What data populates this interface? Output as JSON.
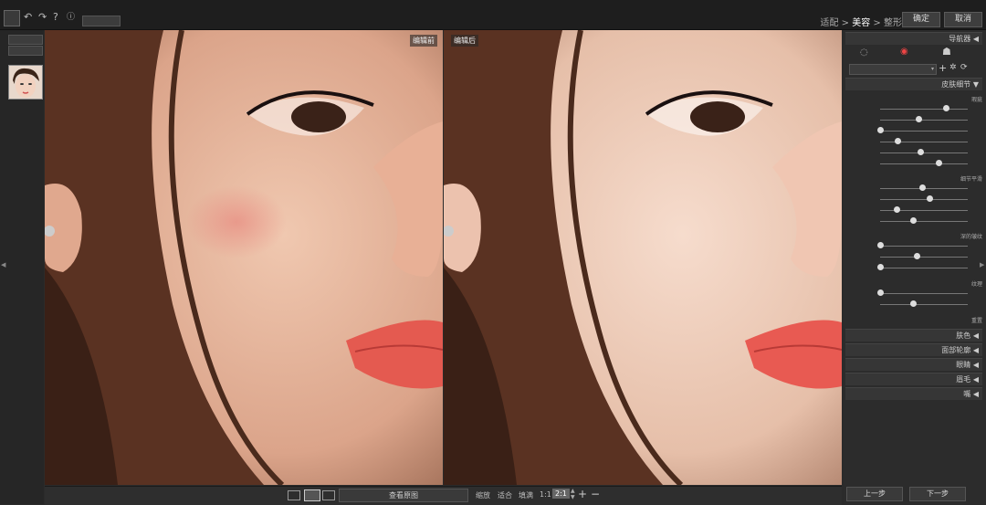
{
  "topbar": {
    "undo_icon": "undo-icon",
    "redo_icon": "redo-icon",
    "help_icon": "question-icon",
    "info_icon": "info-icon",
    "small_button": "",
    "breadcrumb": {
      "step1": "适配",
      "sep1": " > ",
      "step2": "美容",
      "sep2": " > ",
      "step3": "整形"
    },
    "confirm": "确定",
    "cancel": "取消"
  },
  "left_panel": {
    "btn1": "",
    "btn2": ""
  },
  "views": {
    "before_label": "编辑前",
    "after_label": "编辑后"
  },
  "bottom_bar": {
    "main_button": "查看原图",
    "zoom_label": "缩放",
    "fit": "适合",
    "fill": "填满",
    "ratio_1_1": "1:1",
    "ratio_2_1": "2:1"
  },
  "right_panel": {
    "navigator": "导航器",
    "preset_select": "",
    "skin_detail": "皮肤细节",
    "group_defects": "瑕疵",
    "group_detail_smooth": "细节平滑",
    "group_deep_wrinkles": "深的皱纹",
    "group_texture": "纹理",
    "reset": "重置",
    "sections": [
      "肤色",
      "面部轮廓",
      "眼睛",
      "眉毛",
      "嘴"
    ],
    "prev": "上一步",
    "next": "下一步"
  },
  "colors": {
    "accent": "#e44444",
    "bg": "#2b2b2b"
  }
}
